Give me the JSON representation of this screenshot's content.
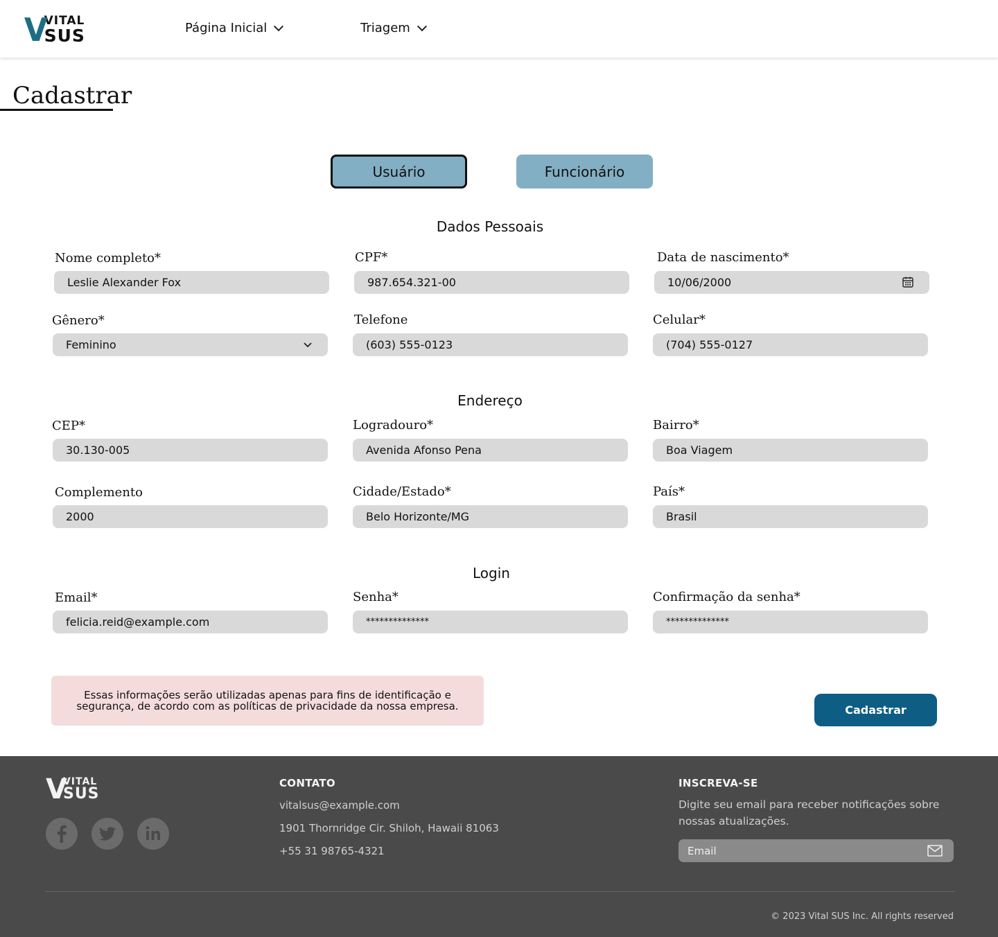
{
  "header": {
    "logo_vital": "VITAL",
    "logo_sus": "SUS",
    "logo_v": "V",
    "nav": [
      {
        "label": "Página Inicial"
      },
      {
        "label": "Triagem"
      }
    ]
  },
  "page_title": "Cadastrar",
  "tabs": [
    {
      "label": "Usuário",
      "active": true
    },
    {
      "label": "Funcionário",
      "active": false
    }
  ],
  "sections": {
    "personal": "Dados Pessoais",
    "address": "Endereço",
    "login": "Login"
  },
  "fields": {
    "nome": {
      "label": "Nome completo*",
      "value": "Leslie Alexander Fox"
    },
    "cpf": {
      "label": "CPF*",
      "value": "987.654.321-00"
    },
    "nascimento": {
      "label": "Data de nascimento*",
      "value": "10/06/2000"
    },
    "genero": {
      "label": "Gênero*",
      "value": "Feminino"
    },
    "telefone": {
      "label": "Telefone",
      "value": "(603) 555-0123"
    },
    "celular": {
      "label": "Celular*",
      "value": "(704) 555-0127"
    },
    "cep": {
      "label": "CEP*",
      "value": "30.130-005"
    },
    "logradouro": {
      "label": "Logradouro*",
      "value": "Avenida Afonso Pena"
    },
    "bairro": {
      "label": "Bairro*",
      "value": "Boa Viagem"
    },
    "complemento": {
      "label": "Complemento",
      "value": "2000"
    },
    "cidade": {
      "label": "Cidade/Estado*",
      "value": "Belo Horizonte/MG"
    },
    "pais": {
      "label": "País*",
      "value": "Brasil"
    },
    "email": {
      "label": "Email*",
      "value": "felicia.reid@example.com"
    },
    "senha": {
      "label": "Senha*",
      "value": "**************"
    },
    "confirmacao": {
      "label": "Confirmação da senha*",
      "value": "**************"
    }
  },
  "notice": "Essas informações serão utilizadas apenas para fins de identificação e segurança, de acordo com as políticas de privacidade da nossa empresa.",
  "submit_label": "Cadastrar",
  "footer": {
    "contact_heading": "CONTATO",
    "contact_email": "vitalsus@example.com",
    "contact_address": "1901 Thornridge Cir. Shiloh, Hawaii 81063",
    "contact_phone": "+55 31 98765-4321",
    "subscribe_heading": "INSCREVA-SE",
    "subscribe_desc": "Digite seu email para receber notificações sobre nossas atualizações.",
    "subscribe_placeholder": "Email",
    "copyright": "© 2023 Vital SUS Inc. All rights reserved",
    "social": [
      "facebook-icon",
      "twitter-icon",
      "linkedin-icon"
    ]
  },
  "colors": {
    "brand_teal": "#1d6e83",
    "tab_blue": "#82afc4",
    "submit_blue": "#0d5d85",
    "field_gray": "#d9d9d9",
    "notice_pink": "#f4dcdd",
    "footer_bg": "#4a4a4a"
  }
}
